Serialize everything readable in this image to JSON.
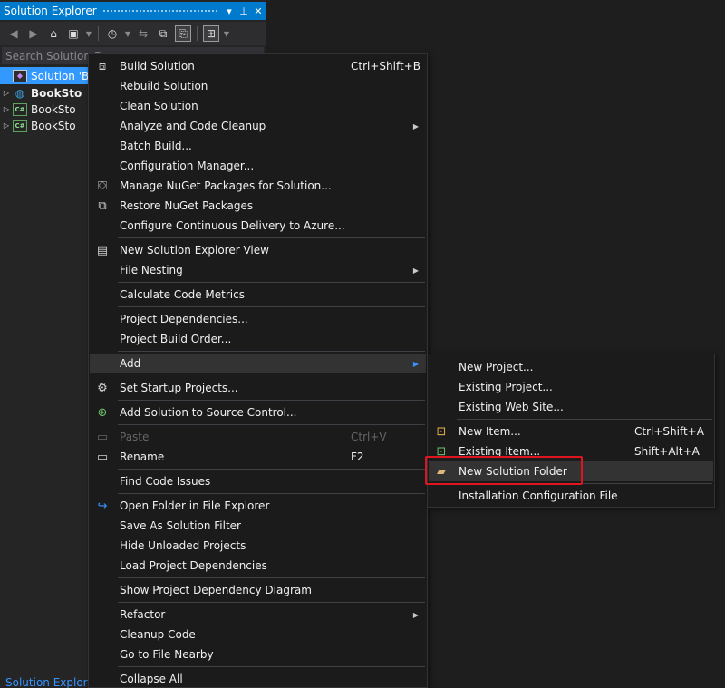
{
  "solution_explorer": {
    "title": "Solution Explorer",
    "pin": "⊥",
    "close": "✕",
    "dropdown": "▾",
    "search_placeholder": "Search Solution E",
    "tree": [
      {
        "label": "Solution 'Bo",
        "icon": "solution-icon",
        "expand": ""
      },
      {
        "label": "BookSto",
        "icon": "web-project-icon",
        "expand": "▷",
        "bold": true
      },
      {
        "label": "BookSto",
        "icon": "csharp-project-icon",
        "expand": "▷"
      },
      {
        "label": "BookSto",
        "icon": "csharp-project-icon",
        "expand": "▷"
      }
    ],
    "footer_tab": "Solution Explorer"
  },
  "context_menu": {
    "items": [
      {
        "label": "Build Solution",
        "shortcut": "Ctrl+Shift+B",
        "icon": "build-icon"
      },
      {
        "label": "Rebuild Solution"
      },
      {
        "label": "Clean Solution"
      },
      {
        "label": "Analyze and Code Cleanup",
        "submenu": true
      },
      {
        "label": "Batch Build..."
      },
      {
        "label": "Configuration Manager..."
      },
      {
        "label": "Manage NuGet Packages for Solution...",
        "icon": "nuget-icon"
      },
      {
        "label": "Restore NuGet Packages",
        "icon": "restore-icon"
      },
      {
        "label": "Configure Continuous Delivery to Azure..."
      },
      {
        "label": "New Solution Explorer View",
        "icon": "new-view-icon"
      },
      {
        "label": "File Nesting",
        "submenu": true
      },
      {
        "label": "Calculate Code Metrics"
      },
      {
        "label": "Project Dependencies..."
      },
      {
        "label": "Project Build Order..."
      },
      {
        "label": "Add",
        "submenu": true,
        "hover": true
      },
      {
        "label": "Set Startup Projects...",
        "icon": "gear-icon"
      },
      {
        "label": "Add Solution to Source Control...",
        "icon": "source-control-icon"
      },
      {
        "label": "Paste",
        "shortcut": "Ctrl+V",
        "icon": "paste-icon",
        "disabled": true
      },
      {
        "label": "Rename",
        "shortcut": "F2",
        "icon": "rename-icon"
      },
      {
        "label": "Find Code Issues"
      },
      {
        "label": "Open Folder in File Explorer",
        "icon": "open-folder-icon"
      },
      {
        "label": "Save As Solution Filter"
      },
      {
        "label": "Hide Unloaded Projects"
      },
      {
        "label": "Load Project Dependencies"
      },
      {
        "label": "Show Project Dependency Diagram"
      },
      {
        "label": "Refactor",
        "submenu": true
      },
      {
        "label": "Cleanup Code"
      },
      {
        "label": "Go to File Nearby"
      },
      {
        "label": "Collapse All"
      }
    ]
  },
  "add_submenu": {
    "items": [
      {
        "label": "New Project..."
      },
      {
        "label": "Existing Project..."
      },
      {
        "label": "Existing Web Site..."
      },
      {
        "label": "New Item...",
        "shortcut": "Ctrl+Shift+A",
        "icon": "new-item-icon"
      },
      {
        "label": "Existing Item...",
        "shortcut": "Shift+Alt+A",
        "icon": "existing-item-icon"
      },
      {
        "label": "New Solution Folder",
        "icon": "new-folder-icon",
        "hover": true,
        "highlighted": true
      },
      {
        "label": "Installation Configuration File"
      }
    ]
  },
  "colors": {
    "accent": "#007acc",
    "selection": "#3399ff",
    "highlight_box": "#e0141e",
    "menu_bg": "#1b1b1c"
  }
}
